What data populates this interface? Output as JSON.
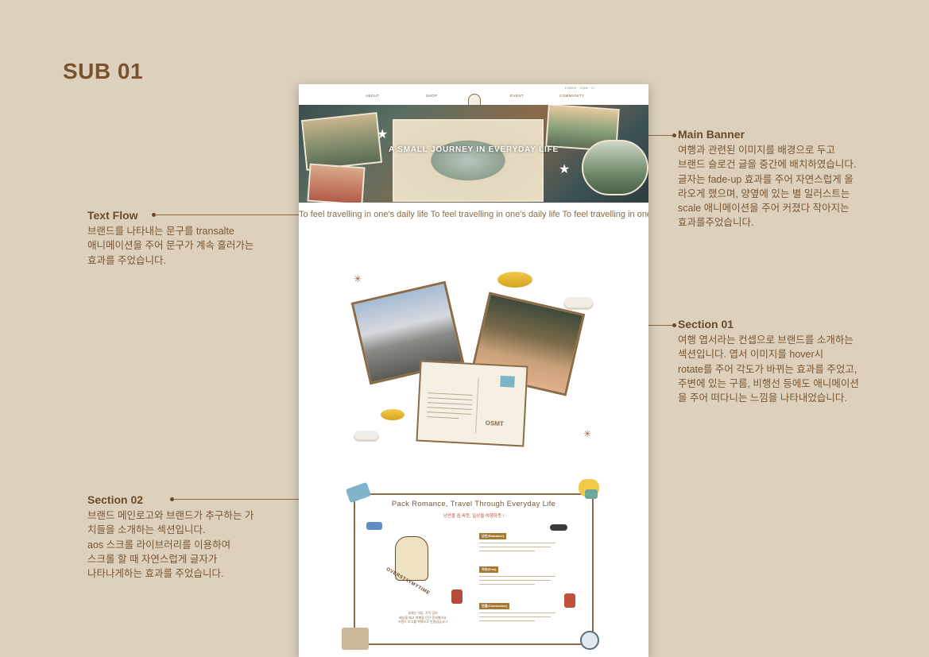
{
  "page_title": "SUB 01",
  "annotations": {
    "main_banner": {
      "title": "Main Banner",
      "desc": "여행과 관련된 이미지를 배경으로 두고\n브랜드 슬로건 글을 중간에 배치하였습니다.\n글자는 fade-up 효과를 주어 자연스럽게 올\n라오게 했으며, 양옆에 있는 별 일러스트는\nscale 애니메이션을 주어 커졌다 작아지는\n효과를주었습니다."
    },
    "text_flow": {
      "title": "Text Flow",
      "desc": "브랜드를 나타내는 문구를 transalte\n애니메이션을 주어 문구가 계속 흘러가는\n효과를 주었습니다."
    },
    "section_01": {
      "title": "Section 01",
      "desc": "여행 엽서라는 컨셉으로 브랜드를 소개하는\n섹션입니다. 엽서 이미지를 hover시\nrotate를 주어 각도가 바뀌는 효과를 주었고,\n주변에 있는 구름, 비행선 등에도 애니메이션\n을 주어 떠다니는 느낌을 나타내었습니다."
    },
    "section_02": {
      "title": "Section 02",
      "desc": "브랜드 메인로고와 브랜드가 추구하는 가\n치들을 소개하는 섹션입니다.\naos 스크롤 라이브러리를 이용하여\n스크롤 할 때 자연스럽게 글자가\n나타나게하는 효과를 주었습니다."
    }
  },
  "mockup": {
    "header": {
      "util": "LOGIN · JOIN · ☐",
      "nav": [
        "ABOUT",
        "SHOP",
        "EVENT",
        "COMMUNITY"
      ]
    },
    "banner": {
      "slogan": "A SMALL JOURNEY IN EVERYDAY LIFE"
    },
    "text_flow": "To feel travelling in one's daily life To feel travelling in one's daily life To feel travelling in one's daily life",
    "section_01": {
      "brand": "OSMT"
    },
    "section_02": {
      "title": "Pack Romance, Travel Through Everyday Life",
      "subtitle": "낭만을 짐 싸듯, 일상을 여행하듯 !",
      "values": [
        "낭만(Romance)",
        "자유(Free)",
        "연결(Connection)"
      ],
      "logo_text": "OVERSTAYMYTIME",
      "tagline": "설레는 마음, 가득 담아\n배낭을 메고 여행을 단단 준비했어요\n브랜드 로고를 백팩으로 만들었습니다"
    }
  },
  "colors": {
    "background": "#ddd1bd",
    "accent": "#6b4a2a",
    "frame": "#8b6c47"
  }
}
